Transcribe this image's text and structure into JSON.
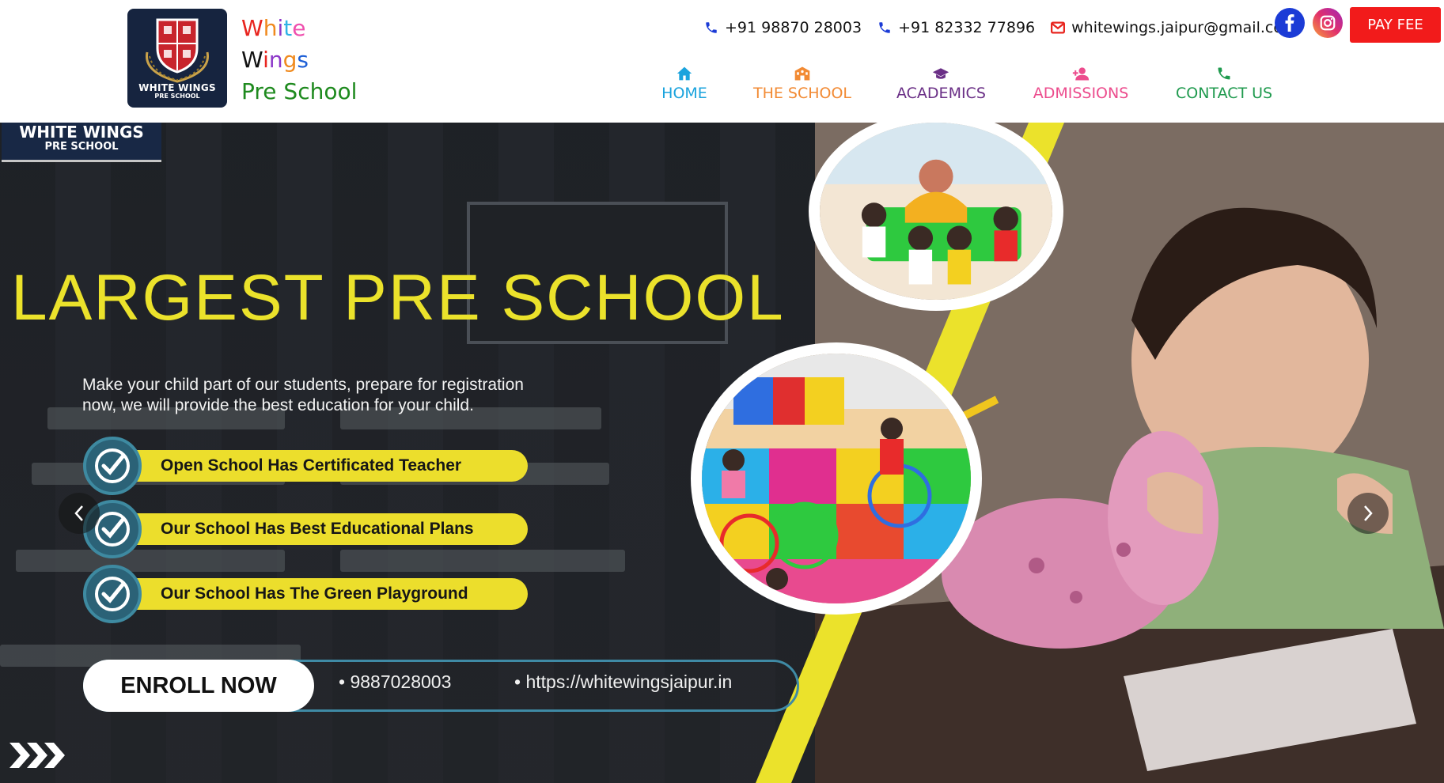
{
  "brand": {
    "logo_line1": "WHITE WINGS",
    "logo_line2": "PRE SCHOOL",
    "name_row1": [
      "W",
      "h",
      "i",
      "t",
      "e"
    ],
    "name_row1_colors": [
      "#e8251f",
      "#f08a1e",
      "#8d38c9",
      "#2fb3e5",
      "#ef4fae"
    ],
    "name_row2": [
      "W",
      "i",
      "n",
      "g",
      "s"
    ],
    "name_row2_colors": [
      "#111111",
      "#e8251f",
      "#8d38c9",
      "#f08a1e",
      "#1d5fd6"
    ],
    "name_row3": "Pre School"
  },
  "contact": {
    "phone1": "+91 98870 28003",
    "phone2": "+91 82332 77896",
    "email": "whitewings.jaipur@gmail.com",
    "phone_icon": "phone-icon",
    "email_icon": "mail-icon"
  },
  "social": {
    "facebook_icon": "facebook-icon",
    "instagram_icon": "instagram-icon"
  },
  "pay_fee": "PAY FEE",
  "nav": {
    "items": [
      {
        "label": "HOME",
        "icon": "home-icon",
        "color": "#1aa3dd"
      },
      {
        "label": "THE SCHOOL",
        "icon": "school-icon",
        "color": "#f28a33"
      },
      {
        "label": "ACADEMICS",
        "icon": "graduation-cap-icon",
        "color": "#6a2f86"
      },
      {
        "label": "ADMISSIONS",
        "icon": "user-plus-icon",
        "color": "#ec4c8d"
      },
      {
        "label": "CONTACT US",
        "icon": "phone-icon",
        "color": "#1f9a4e"
      }
    ]
  },
  "hero": {
    "badge_line1": "WHITE WINGS",
    "badge_line2": "PRE SCHOOL",
    "headline": "LARGEST PRE SCHOOL",
    "subtext_line1": "Make your child part of our students, prepare for registration",
    "subtext_line2": "now, we will provide the best education for your child.",
    "features": [
      "Open School Has Certificated Teacher",
      "Our School Has Best Educational Plans",
      "Our School Has The Green Playground"
    ],
    "enroll_label": "ENROLL NOW",
    "enroll_phone": "9887028003",
    "enroll_url": "https://whitewingsjaipur.in",
    "accent_yellow": "#ecde2c",
    "accent_teal": "#3f8aa5"
  },
  "carousel": {
    "prev_icon": "chevron-left-icon",
    "next_icon": "chevron-right-icon"
  }
}
